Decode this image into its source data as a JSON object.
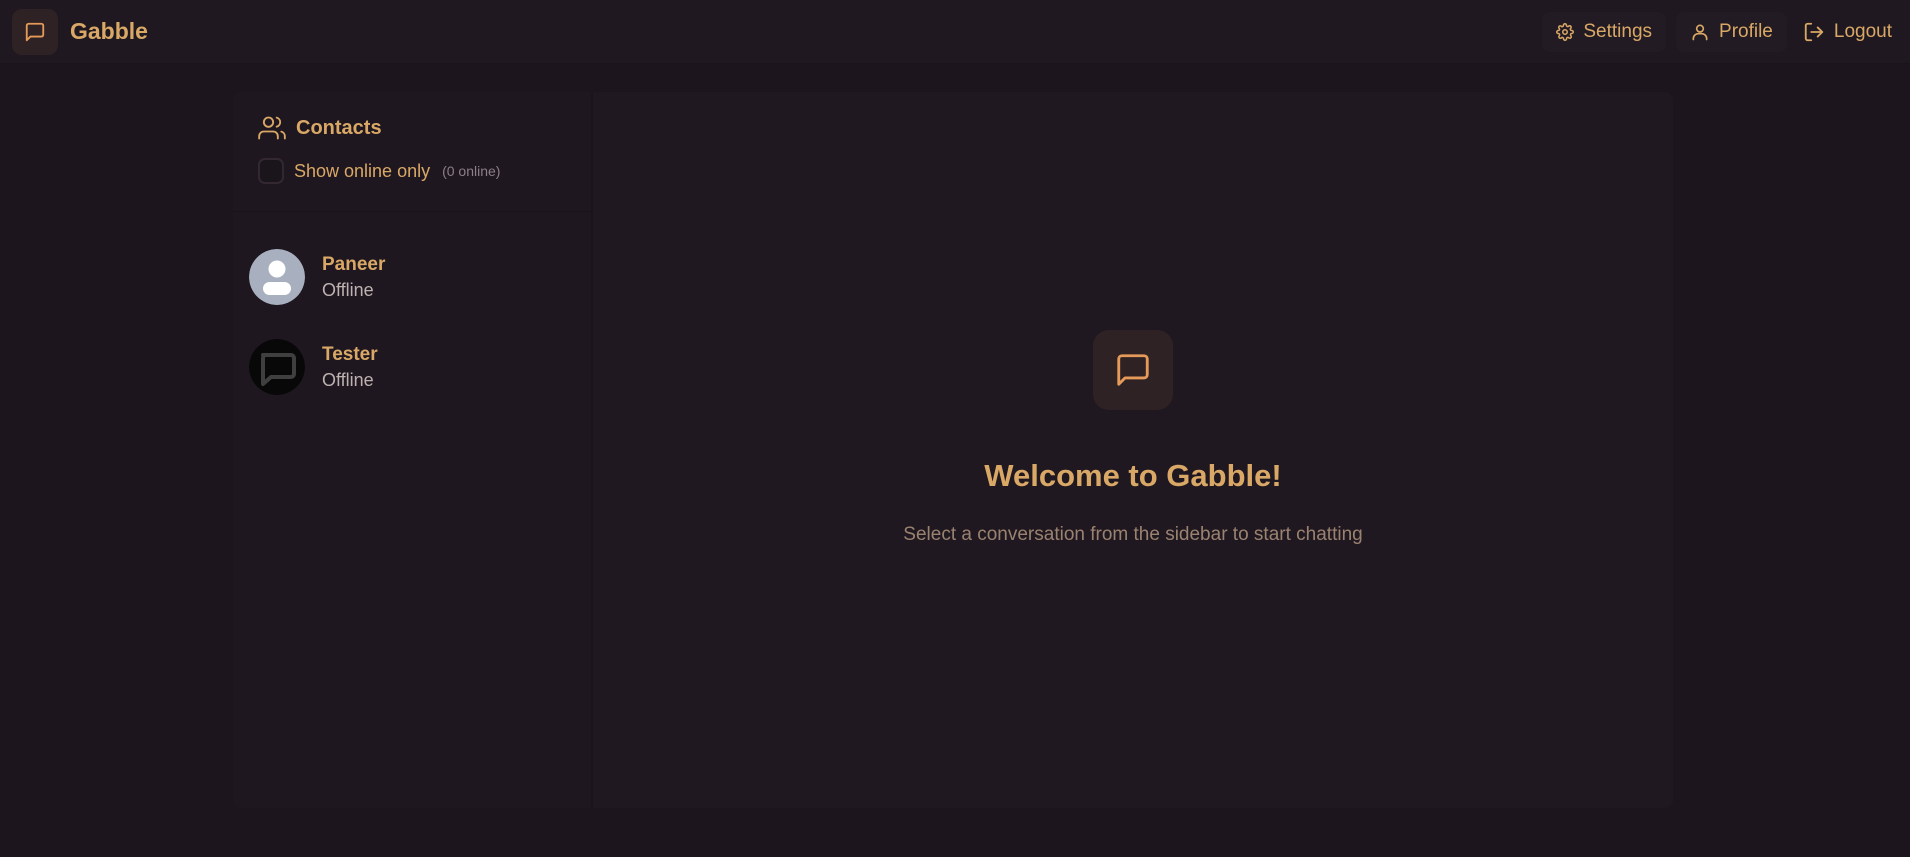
{
  "header": {
    "brand_name": "Gabble",
    "nav": {
      "settings_label": "Settings",
      "profile_label": "Profile",
      "logout_label": "Logout"
    }
  },
  "sidebar": {
    "title": "Contacts",
    "toggle_label": "Show online only",
    "online_count": "(0 online)",
    "toggle_checked": false,
    "contacts": [
      {
        "name": "Paneer",
        "status": "Offline",
        "avatar": "default-user-avatar"
      },
      {
        "name": "Tester",
        "status": "Offline",
        "avatar": "chat-bubble-avatar"
      }
    ]
  },
  "chat": {
    "welcome_title": "Welcome to Gabble!",
    "welcome_subtitle": "Select a conversation from the sidebar to start chatting"
  },
  "colors": {
    "background": "#1c151d",
    "accent": "#d9a866",
    "icon_accent": "#e69a5a",
    "muted_text": "#9a8270"
  }
}
